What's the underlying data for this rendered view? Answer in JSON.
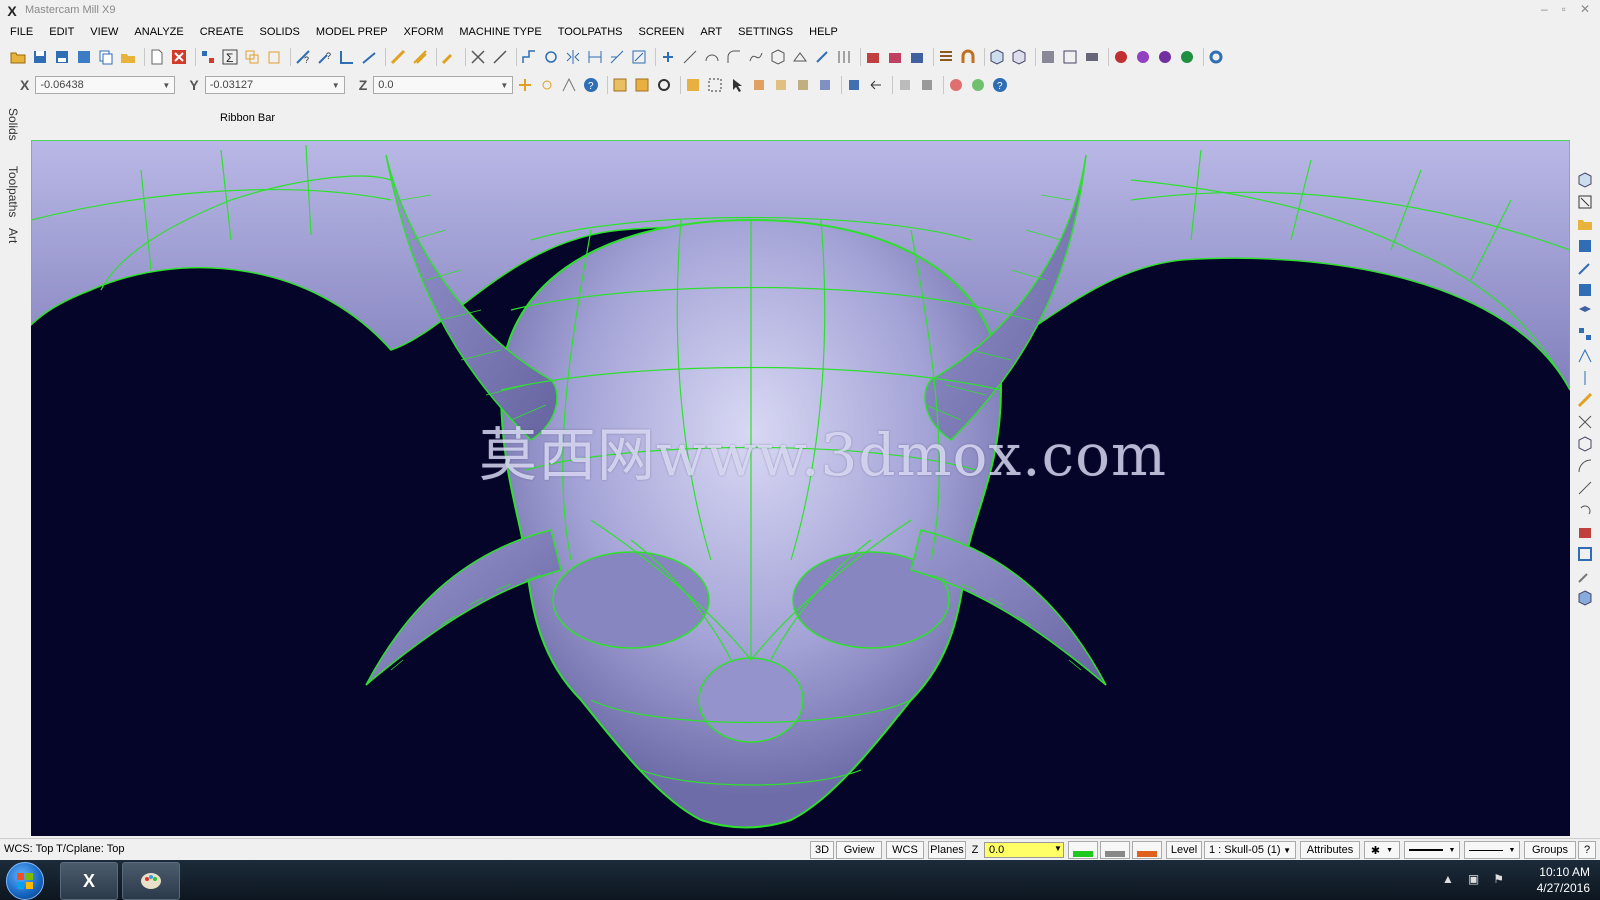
{
  "window": {
    "title": "Mastercam Mill X9",
    "controls": [
      "–",
      "▫",
      "✕"
    ]
  },
  "menu": [
    "FILE",
    "EDIT",
    "VIEW",
    "ANALYZE",
    "CREATE",
    "SOLIDS",
    "MODEL PREP",
    "XFORM",
    "MACHINE TYPE",
    "TOOLPATHS",
    "SCREEN",
    "ART",
    "SETTINGS",
    "HELP"
  ],
  "coords": {
    "x_label": "X",
    "x_value": "-0.06438",
    "y_label": "Y",
    "y_value": "-0.03127",
    "z_label": "Z",
    "z_value": "0.0"
  },
  "ribbon_label": "Ribbon Bar",
  "left_tabs": [
    "Solids",
    "Toolpaths",
    "Art"
  ],
  "viewport": {
    "watermark": "莫西网www.3dmox.com",
    "background": "#05052a",
    "model_color": "#a9a8d8",
    "wire_color": "#2ee02e"
  },
  "status": {
    "wcs": "WCS: Top  T/Cplane: Top",
    "btn_3d": "3D",
    "btn_gview": "Gview",
    "btn_wcs": "WCS",
    "btn_planes": "Planes",
    "z_label": "Z",
    "z_value": "0.0",
    "level_label": "Level",
    "level_value": "1 : Skull-05 (1)",
    "attributes": "Attributes",
    "groups": "Groups",
    "help": "?"
  },
  "taskbar": {
    "time": "10:10 AM",
    "date": "4/27/2016"
  }
}
